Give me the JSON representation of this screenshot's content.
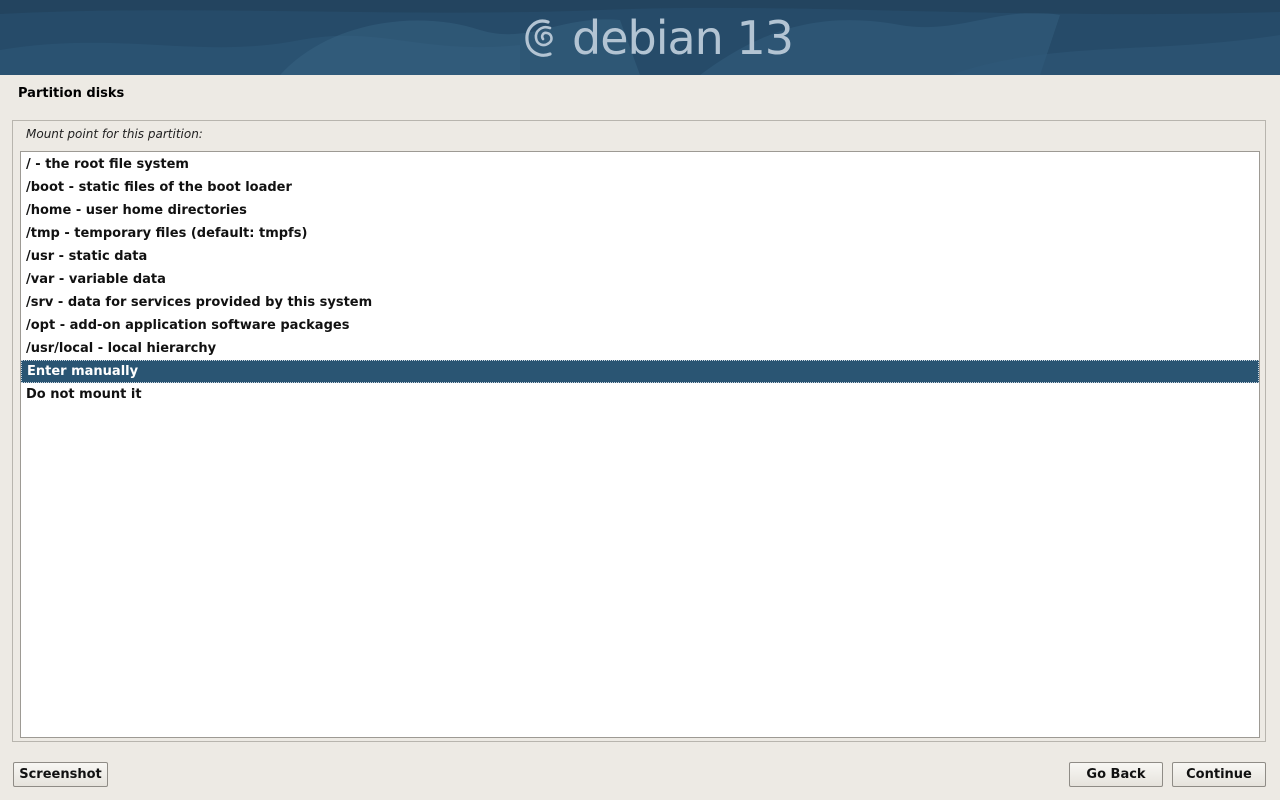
{
  "header": {
    "logo_text": "debian 13",
    "icon": "debian-swirl-icon"
  },
  "step": {
    "title": "Partition disks"
  },
  "question": {
    "label": "Mount point for this partition:"
  },
  "options": [
    {
      "label": "/ - the root file system",
      "selected": false
    },
    {
      "label": "/boot - static files of the boot loader",
      "selected": false
    },
    {
      "label": "/home - user home directories",
      "selected": false
    },
    {
      "label": "/tmp - temporary files (default: tmpfs)",
      "selected": false
    },
    {
      "label": "/usr - static data",
      "selected": false
    },
    {
      "label": "/var - variable data",
      "selected": false
    },
    {
      "label": "/srv - data for services provided by this system",
      "selected": false
    },
    {
      "label": "/opt - add-on application software packages",
      "selected": false
    },
    {
      "label": "/usr/local - local hierarchy",
      "selected": false
    },
    {
      "label": "Enter manually",
      "selected": true
    },
    {
      "label": "Do not mount it",
      "selected": false
    }
  ],
  "buttons": {
    "screenshot": "Screenshot",
    "go_back": "Go Back",
    "continue": "Continue"
  },
  "colors": {
    "banner": "#264b69",
    "selection": "#2a5573",
    "background": "#edeae4"
  }
}
